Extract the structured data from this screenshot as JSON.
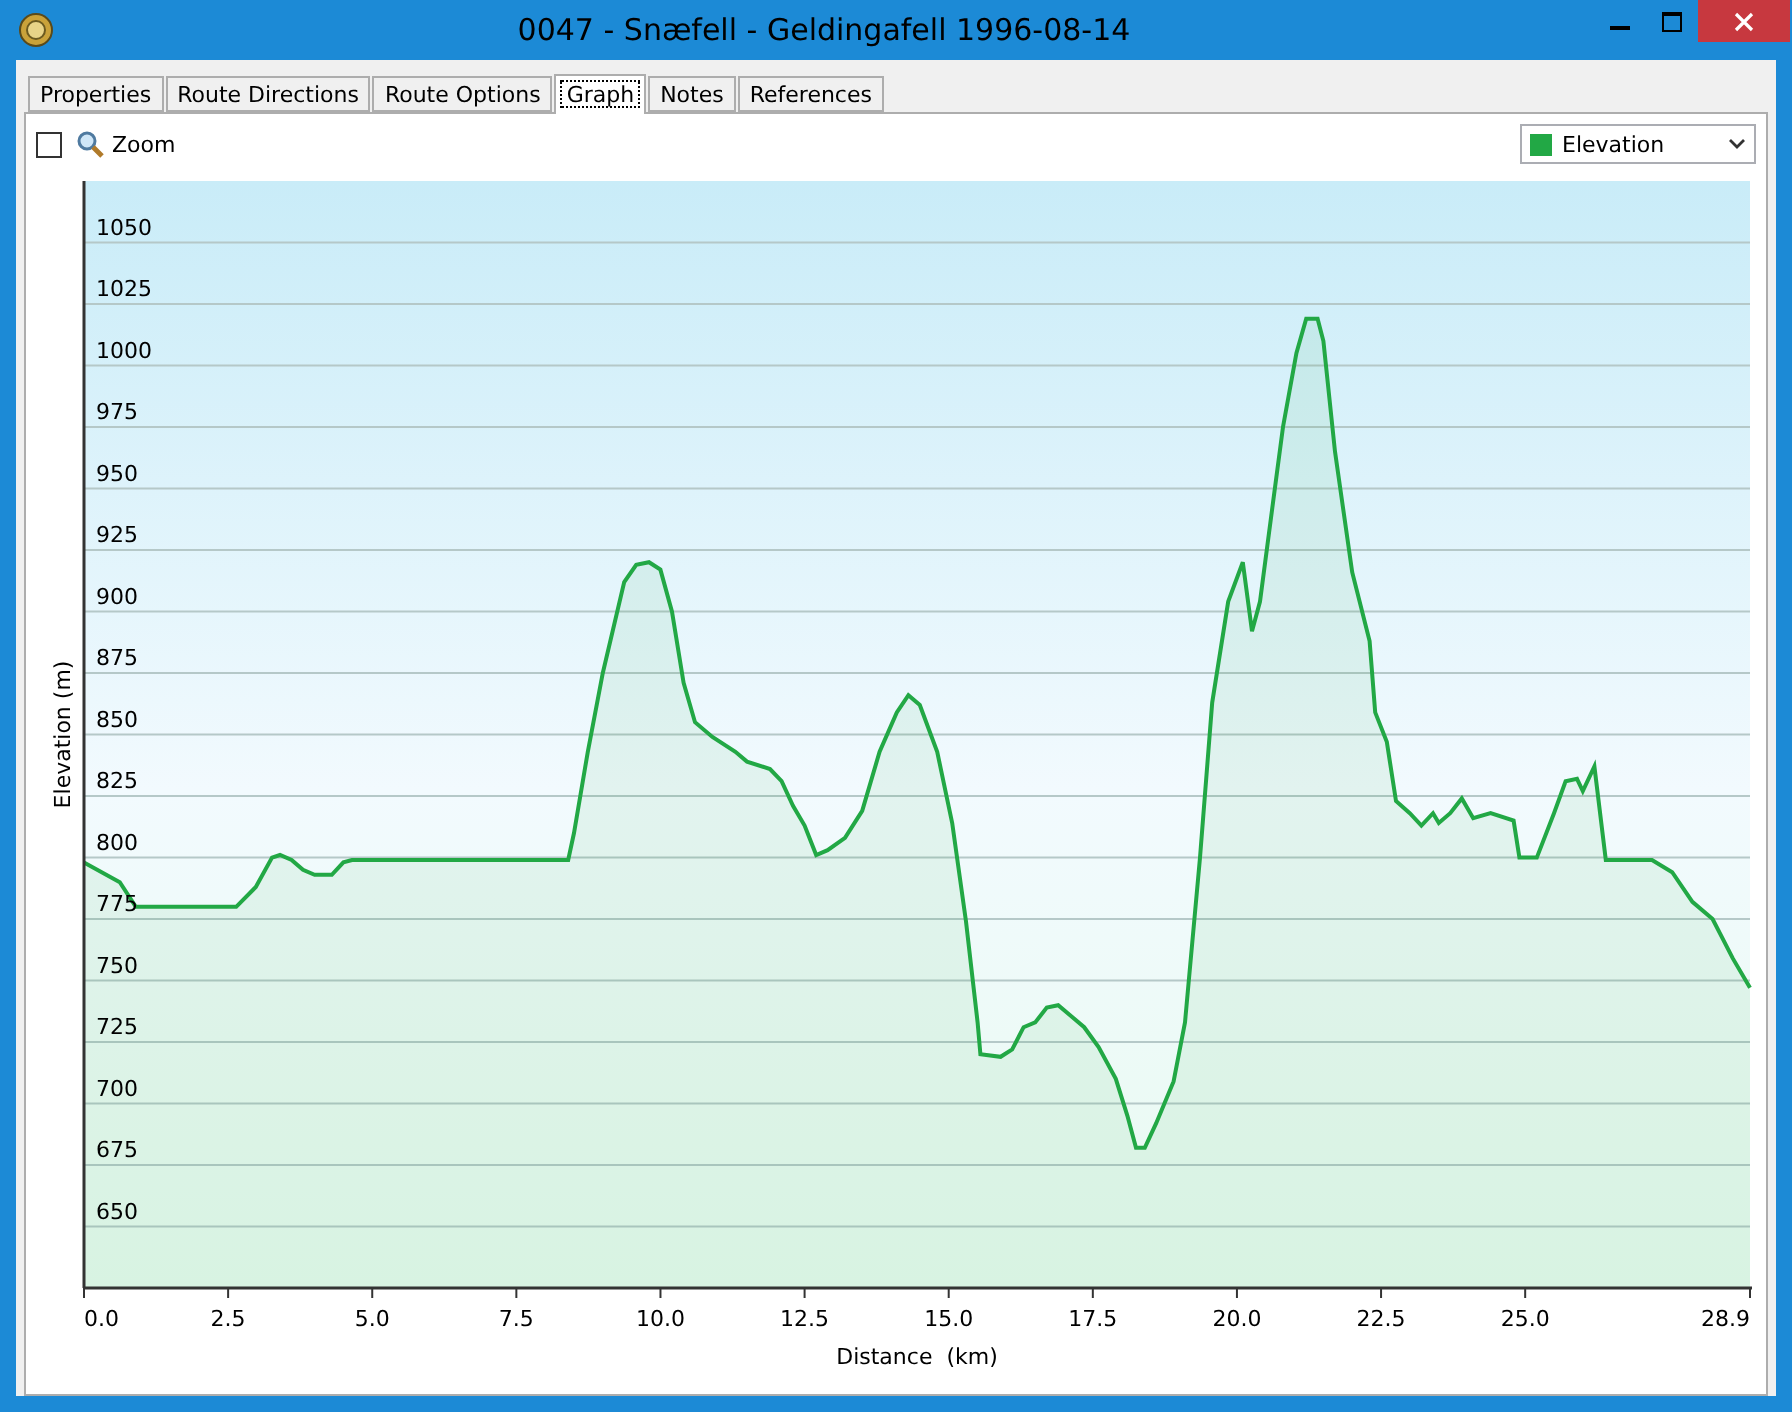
{
  "window": {
    "title": "0047 - Snæfell - Geldingafell 1996-08-14"
  },
  "tabs": [
    {
      "label": "Properties",
      "selected": false
    },
    {
      "label": "Route Directions",
      "selected": false
    },
    {
      "label": "Route Options",
      "selected": false
    },
    {
      "label": "Graph",
      "selected": true
    },
    {
      "label": "Notes",
      "selected": false
    },
    {
      "label": "References",
      "selected": false
    }
  ],
  "toolbar": {
    "zoom": {
      "label": "Zoom",
      "checked": false
    }
  },
  "graph": {
    "chart_data": {
      "type": "area",
      "xlabel": "Distance  (km)",
      "ylabel": "Elevation (m)",
      "x": [
        0,
        0.62,
        0.9,
        2.64,
        2.98,
        3.26,
        3.4,
        3.6,
        3.8,
        4.0,
        4.3,
        4.5,
        4.65,
        8.4,
        8.5,
        8.74,
        9.0,
        9.37,
        9.58,
        9.8,
        10.0,
        10.2,
        10.4,
        10.6,
        10.9,
        11.3,
        11.5,
        11.9,
        12.1,
        12.3,
        12.5,
        12.7,
        12.9,
        13.2,
        13.5,
        13.8,
        14.1,
        14.3,
        14.5,
        14.8,
        15.06,
        15.3,
        15.5,
        15.55,
        15.9,
        16.1,
        16.3,
        16.5,
        16.7,
        16.9,
        17.1,
        17.35,
        17.6,
        17.9,
        18.1,
        18.25,
        18.4,
        18.6,
        18.9,
        19.1,
        19.36,
        19.57,
        19.85,
        20.1,
        20.26,
        20.4,
        20.6,
        20.8,
        21.03,
        21.2,
        21.4,
        21.5,
        21.7,
        22.0,
        22.3,
        22.4,
        22.6,
        22.76,
        23.0,
        23.2,
        23.4,
        23.5,
        23.7,
        23.9,
        24.1,
        24.4,
        24.8,
        24.9,
        25.2,
        25.5,
        25.7,
        25.9,
        26.0,
        26.2,
        26.4,
        27.2,
        27.55,
        27.9,
        28.25,
        28.6,
        28.9
      ],
      "series": [
        {
          "name": "Elevation",
          "color": "#22a845",
          "values": [
            798,
            790,
            780,
            780,
            788,
            800,
            801,
            799,
            795,
            793,
            793,
            798,
            799,
            799,
            810,
            843,
            875,
            912,
            919,
            920,
            917,
            900,
            871,
            855,
            849,
            843,
            839,
            836,
            831,
            821,
            813,
            801,
            803,
            808,
            819,
            843,
            859,
            866,
            862,
            843,
            814,
            774,
            733,
            720,
            719,
            722,
            731,
            733,
            739,
            740,
            736,
            731,
            723,
            710,
            695,
            682,
            682,
            692,
            709,
            733,
            800,
            863,
            904,
            920,
            892,
            904,
            940,
            975,
            1005,
            1019,
            1019,
            1010,
            965,
            916,
            888,
            859,
            847,
            823,
            818,
            813,
            818,
            814,
            818,
            824,
            816,
            818,
            815,
            800,
            800,
            818,
            831,
            832,
            827,
            837,
            799,
            799,
            794,
            782,
            775,
            759,
            747
          ]
        }
      ],
      "xlim": [
        0,
        28.9
      ],
      "ylim": [
        625,
        1075
      ],
      "grid": true,
      "xticks": [
        {
          "value": 0,
          "label": "0.0"
        },
        2.5,
        {
          "value": 5,
          "label": "5.0"
        },
        7.5,
        {
          "value": 10,
          "label": "10.0"
        },
        12.5,
        {
          "value": 15,
          "label": "15.0"
        },
        17.5,
        {
          "value": 20,
          "label": "20.0"
        },
        22.5,
        {
          "value": 25,
          "label": "25.0"
        },
        28.9
      ],
      "yticks": [
        650,
        675,
        700,
        725,
        750,
        775,
        800,
        825,
        850,
        875,
        900,
        925,
        950,
        975,
        1000,
        1025,
        1050
      ]
    }
  }
}
